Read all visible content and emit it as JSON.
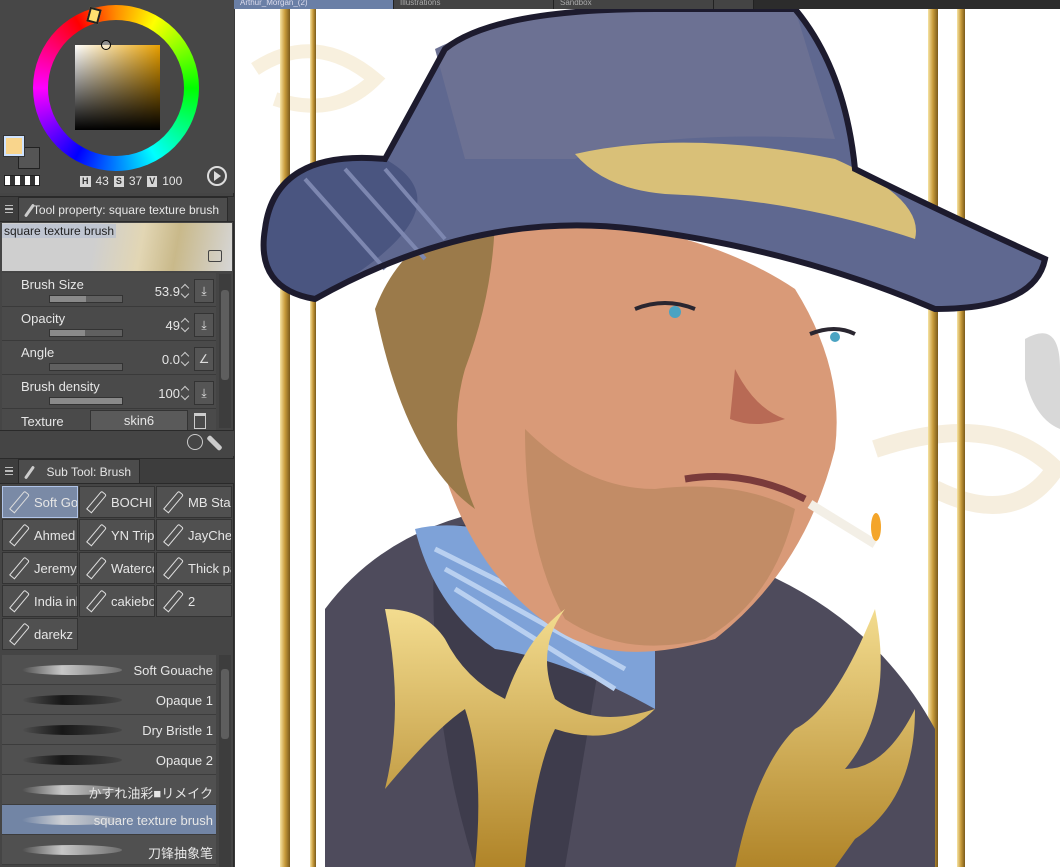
{
  "document_tabs": [
    "Arthur_Morgan_(2)",
    "Illustrations",
    "Sandbox",
    ""
  ],
  "color": {
    "hsv": {
      "h_label": "H",
      "h": "43",
      "s_label": "S",
      "s": "37",
      "v_label": "V",
      "v": "100"
    },
    "foreground": "#f9d58c"
  },
  "tool_property": {
    "tab_label": "Tool property: square texture brush",
    "brush_name": "square texture brush",
    "props": [
      {
        "label": "Brush Size",
        "value": "53.9",
        "fill": 0.5
      },
      {
        "label": "Opacity",
        "value": "49",
        "fill": 0.49
      },
      {
        "label": "Angle",
        "value": "0.0",
        "fill": 0.0
      },
      {
        "label": "Brush density",
        "value": "100",
        "fill": 1.0
      }
    ],
    "texture_label": "Texture",
    "texture_value": "skin6"
  },
  "sub_tool": {
    "tab_label": "Sub Tool: Brush",
    "groups": [
      "Soft Gouache",
      "BOCHI",
      "MB Stamps",
      "Ahmed",
      "YN Trip",
      "JayChen",
      "Jeremy",
      "Watercolor",
      "Thick paint",
      "India ink",
      "cakieboo",
      "2",
      "darekz"
    ],
    "brushes": [
      {
        "label": "Soft Gouache",
        "dark": false
      },
      {
        "label": "Opaque 1",
        "dark": true
      },
      {
        "label": "Dry Bristle 1",
        "dark": true
      },
      {
        "label": "Opaque 2",
        "dark": true
      },
      {
        "label": "かすれ油彩■リメイク",
        "dark": false
      },
      {
        "label": "square texture brush",
        "dark": false
      },
      {
        "label": "刀锋抽象笔",
        "dark": false
      }
    ]
  }
}
